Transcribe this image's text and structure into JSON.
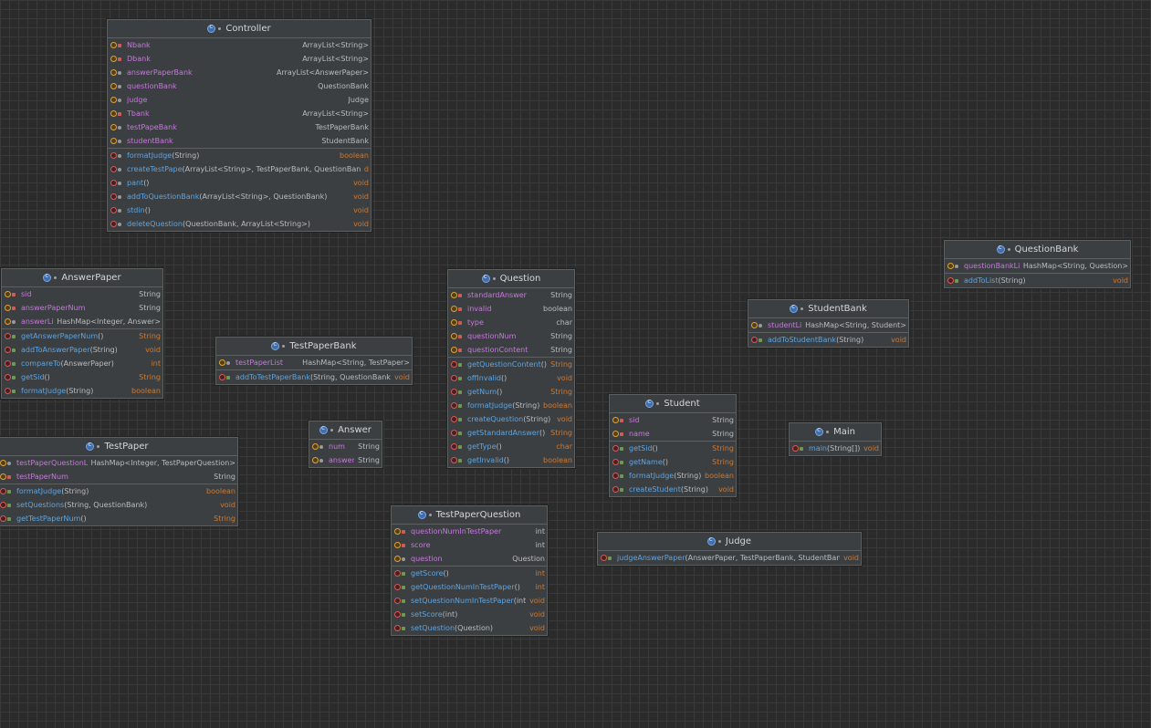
{
  "classes": {
    "controller": {
      "name": "Controller",
      "fields": [
        {
          "name": "Nbank",
          "type": "ArrayList<String>",
          "vis": "private"
        },
        {
          "name": "Dbank",
          "type": "ArrayList<String>",
          "vis": "private"
        },
        {
          "name": "answerPaperBank",
          "type": "ArrayList<AnswerPaper>",
          "vis": "package"
        },
        {
          "name": "questionBank",
          "type": "QuestionBank",
          "vis": "package"
        },
        {
          "name": "judge",
          "type": "Judge",
          "vis": "package"
        },
        {
          "name": "Tbank",
          "type": "ArrayList<String>",
          "vis": "private"
        },
        {
          "name": "testPapeBank",
          "type": "TestPaperBank",
          "vis": "package"
        },
        {
          "name": "studentBank",
          "type": "StudentBank",
          "vis": "package"
        }
      ],
      "methods": [
        {
          "name": "formatJudge",
          "params": "(String)",
          "type": "boolean",
          "vis": "package"
        },
        {
          "name": "createTestPape",
          "params": "(ArrayList<String>, TestPaperBank, QuestionBank)",
          "type": "d",
          "vis": "package"
        },
        {
          "name": "pant",
          "params": "()",
          "type": "void",
          "vis": "package"
        },
        {
          "name": "addToQuestionBank",
          "params": "(ArrayList<String>, QuestionBank)",
          "type": "void",
          "vis": "package"
        },
        {
          "name": "stdin",
          "params": "()",
          "type": "void",
          "vis": "package"
        },
        {
          "name": "deleteQuestion",
          "params": "(QuestionBank, ArrayList<String>)",
          "type": "void",
          "vis": "package"
        }
      ]
    },
    "answer_paper": {
      "name": "AnswerPaper",
      "fields": [
        {
          "name": "sid",
          "type": "String",
          "vis": "private"
        },
        {
          "name": "answerPaperNum",
          "type": "String",
          "vis": "private"
        },
        {
          "name": "answerList",
          "type": "HashMap<Integer, Answer>",
          "vis": "package"
        }
      ],
      "methods": [
        {
          "name": "getAnswerPaperNum",
          "params": "()",
          "type": "String",
          "vis": "public"
        },
        {
          "name": "addToAnswerPaper",
          "params": "(String)",
          "type": "void",
          "vis": "public"
        },
        {
          "name": "compareTo",
          "params": "(AnswerPaper)",
          "type": "int",
          "vis": "public"
        },
        {
          "name": "getSid",
          "params": "()",
          "type": "String",
          "vis": "public"
        },
        {
          "name": "formatJudge",
          "params": "(String)",
          "type": "boolean",
          "vis": "public"
        }
      ]
    },
    "test_paper": {
      "name": "TestPaper",
      "fields": [
        {
          "name": "testPaperQuestionList",
          "type": "HashMap<Integer, TestPaperQuestion>",
          "vis": "package"
        },
        {
          "name": "testPaperNum",
          "type": "String",
          "vis": "private"
        }
      ],
      "methods": [
        {
          "name": "formatJudge",
          "params": "(String)",
          "type": "boolean",
          "vis": "public"
        },
        {
          "name": "setQuestions",
          "params": "(String, QuestionBank)",
          "type": "void",
          "vis": "public"
        },
        {
          "name": "getTestPaperNum",
          "params": "()",
          "type": "String",
          "vis": "public"
        }
      ]
    },
    "test_paper_bank": {
      "name": "TestPaperBank",
      "fields": [
        {
          "name": "testPaperList",
          "type": "HashMap<String, TestPaper>",
          "vis": "package"
        }
      ],
      "methods": [
        {
          "name": "addToTestPaperBank",
          "params": "(String, QuestionBank)",
          "type": "void",
          "vis": "public"
        }
      ]
    },
    "answer": {
      "name": "Answer",
      "fields": [
        {
          "name": "num",
          "type": "String",
          "vis": "package"
        },
        {
          "name": "answer",
          "type": "String",
          "vis": "package"
        }
      ],
      "methods": []
    },
    "question": {
      "name": "Question",
      "fields": [
        {
          "name": "standardAnswer",
          "type": "String",
          "vis": "private"
        },
        {
          "name": "invalid",
          "type": "boolean",
          "vis": "private"
        },
        {
          "name": "type",
          "type": "char",
          "vis": "private"
        },
        {
          "name": "questionNum",
          "type": "String",
          "vis": "private"
        },
        {
          "name": "questionContent",
          "type": "String",
          "vis": "private"
        }
      ],
      "methods": [
        {
          "name": "getQuestionContent",
          "params": "()",
          "type": "String",
          "vis": "public"
        },
        {
          "name": "offInvalid",
          "params": "()",
          "type": "void",
          "vis": "public"
        },
        {
          "name": "getNum",
          "params": "()",
          "type": "String",
          "vis": "public"
        },
        {
          "name": "formatJudge",
          "params": "(String)",
          "type": "boolean",
          "vis": "public"
        },
        {
          "name": "createQuestion",
          "params": "(String)",
          "type": "void",
          "vis": "public"
        },
        {
          "name": "getStandardAnswer",
          "params": "()",
          "type": "String",
          "vis": "public"
        },
        {
          "name": "getType",
          "params": "()",
          "type": "char",
          "vis": "public"
        },
        {
          "name": "getInvalid",
          "params": "()",
          "type": "boolean",
          "vis": "public"
        }
      ]
    },
    "test_paper_question": {
      "name": "TestPaperQuestion",
      "fields": [
        {
          "name": "questionNumInTestPaper",
          "type": "int",
          "vis": "private"
        },
        {
          "name": "score",
          "type": "int",
          "vis": "private"
        },
        {
          "name": "question",
          "type": "Question",
          "vis": "package"
        }
      ],
      "methods": [
        {
          "name": "getScore",
          "params": "()",
          "type": "int",
          "vis": "public"
        },
        {
          "name": "getQuestionNumInTestPaper",
          "params": "()",
          "type": "int",
          "vis": "public"
        },
        {
          "name": "setQuestionNumInTestPaper",
          "params": "(int)",
          "type": "void",
          "vis": "public"
        },
        {
          "name": "setScore",
          "params": "(int)",
          "type": "void",
          "vis": "public"
        },
        {
          "name": "setQuestion",
          "params": "(Question)",
          "type": "void",
          "vis": "public"
        }
      ]
    },
    "student": {
      "name": "Student",
      "fields": [
        {
          "name": "sid",
          "type": "String",
          "vis": "private"
        },
        {
          "name": "name",
          "type": "String",
          "vis": "private"
        }
      ],
      "methods": [
        {
          "name": "getSid",
          "params": "()",
          "type": "String",
          "vis": "public"
        },
        {
          "name": "getName",
          "params": "()",
          "type": "String",
          "vis": "public"
        },
        {
          "name": "formatJudge",
          "params": "(String)",
          "type": "boolean",
          "vis": "public"
        },
        {
          "name": "createStudent",
          "params": "(String)",
          "type": "void",
          "vis": "public"
        }
      ]
    },
    "student_bank": {
      "name": "StudentBank",
      "fields": [
        {
          "name": "studentList",
          "type": "HashMap<String, Student>",
          "vis": "package"
        }
      ],
      "methods": [
        {
          "name": "addToStudentBank",
          "params": "(String)",
          "type": "void",
          "vis": "public"
        }
      ]
    },
    "question_bank": {
      "name": "QuestionBank",
      "fields": [
        {
          "name": "questionBankList",
          "type": "HashMap<String, Question>",
          "vis": "package"
        }
      ],
      "methods": [
        {
          "name": "addToList",
          "params": "(String)",
          "type": "void",
          "vis": "public"
        }
      ]
    },
    "main": {
      "name": "Main",
      "fields": [],
      "methods": [
        {
          "name": "main",
          "params": "(String[])",
          "type": "void",
          "vis": "public"
        }
      ]
    },
    "judge": {
      "name": "Judge",
      "fields": [],
      "methods": [
        {
          "name": "judgeAnswerPaper",
          "params": "(AnswerPaper, TestPaperBank, StudentBank)",
          "type": "void",
          "vis": "public"
        }
      ]
    }
  }
}
